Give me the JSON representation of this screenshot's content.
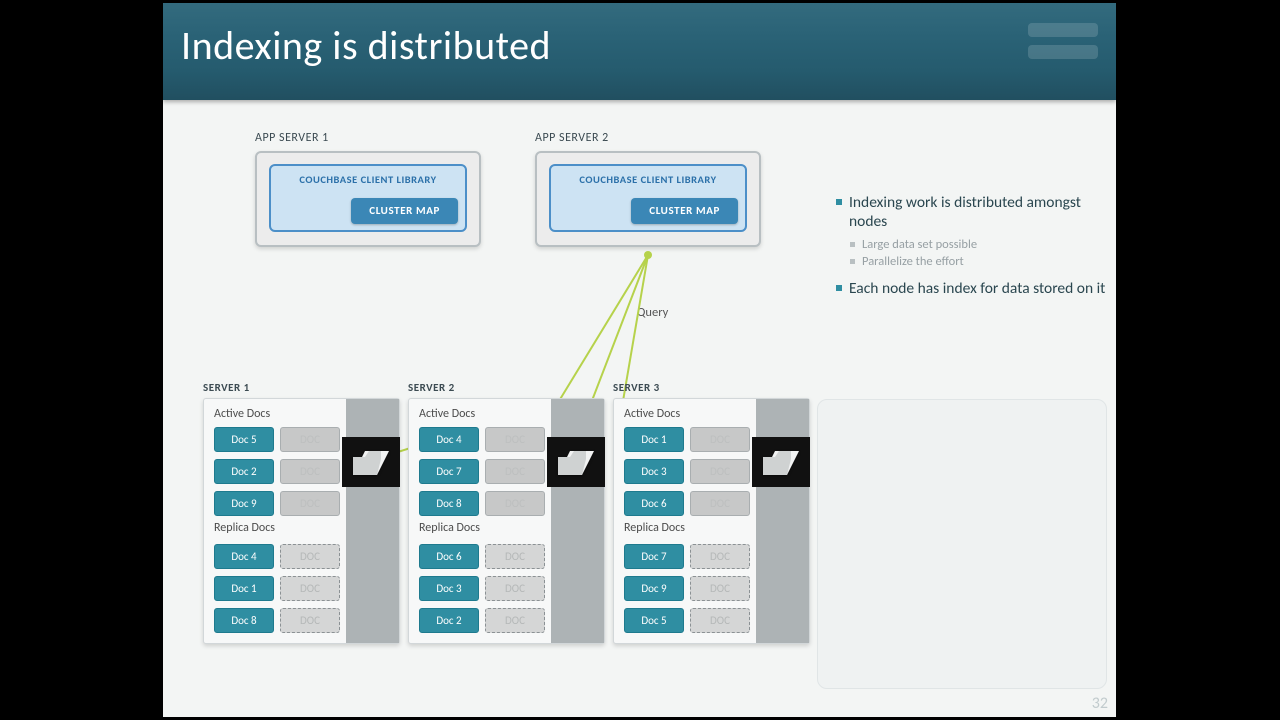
{
  "title": "Indexing is distributed",
  "page_number": "32",
  "query_label": "Query",
  "app_servers": [
    {
      "label": "APP SERVER 1",
      "lib": "COUCHBASE CLIENT LIBRARY",
      "map": "CLUSTER MAP"
    },
    {
      "label": "APP SERVER 2",
      "lib": "COUCHBASE CLIENT LIBRARY",
      "map": "CLUSTER MAP"
    }
  ],
  "servers": [
    {
      "label": "SERVER 1",
      "active_title": "Active Docs",
      "replica_title": "Replica Docs",
      "active": [
        "Doc 5",
        "Doc 2",
        "Doc 9"
      ],
      "replica": [
        "Doc 4",
        "Doc 1",
        "Doc 8"
      ]
    },
    {
      "label": "SERVER 2",
      "active_title": "Active Docs",
      "replica_title": "Replica Docs",
      "active": [
        "Doc 4",
        "Doc 7",
        "Doc 8"
      ],
      "replica": [
        "Doc 6",
        "Doc 3",
        "Doc 2"
      ]
    },
    {
      "label": "SERVER 3",
      "active_title": "Active Docs",
      "replica_title": "Replica Docs",
      "active": [
        "Doc 1",
        "Doc 3",
        "Doc 6"
      ],
      "replica": [
        "Doc 7",
        "Doc 9",
        "Doc 5"
      ]
    }
  ],
  "bullets": {
    "main1": "Indexing work is distributed amongst nodes",
    "sub1": "Large data set possible",
    "sub2": "Parallelize the effort",
    "main2": "Each node has index for data stored on it"
  }
}
